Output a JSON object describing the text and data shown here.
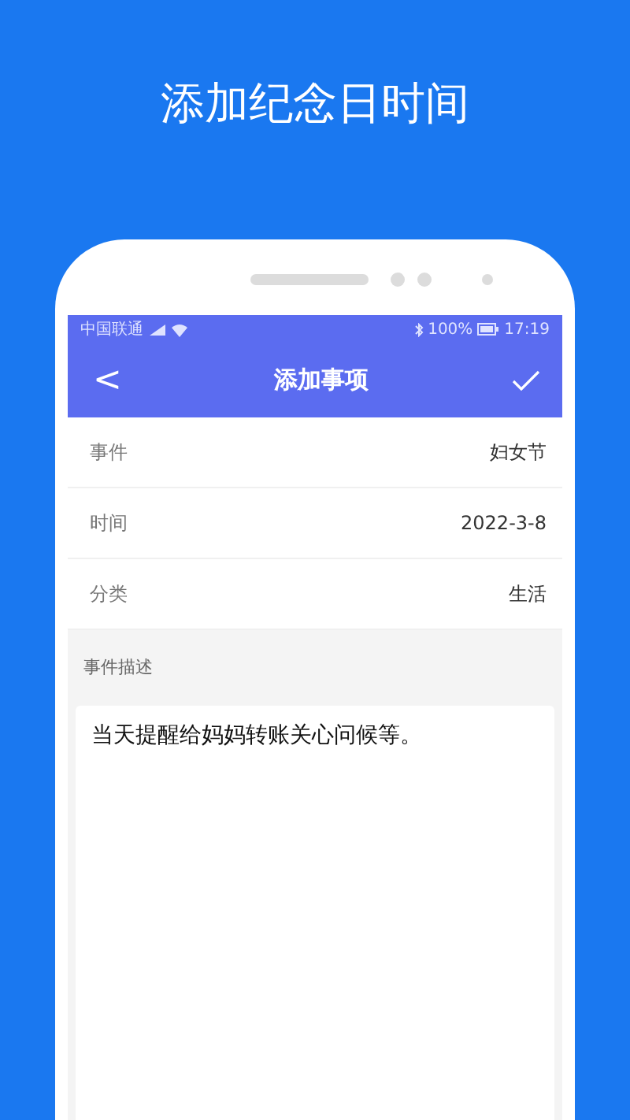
{
  "headline": "添加纪念日时间",
  "status_bar": {
    "carrier": "中国联通",
    "battery": "100%",
    "time": "17:19"
  },
  "nav": {
    "back": "<",
    "title": "添加事项"
  },
  "fields": [
    {
      "label": "事件",
      "value": "妇女节"
    },
    {
      "label": "时间",
      "value": "2022-3-8"
    },
    {
      "label": "分类",
      "value": "生活"
    }
  ],
  "description": {
    "label": "事件描述",
    "value": "当天提醒给妈妈转账关心问候等。"
  }
}
